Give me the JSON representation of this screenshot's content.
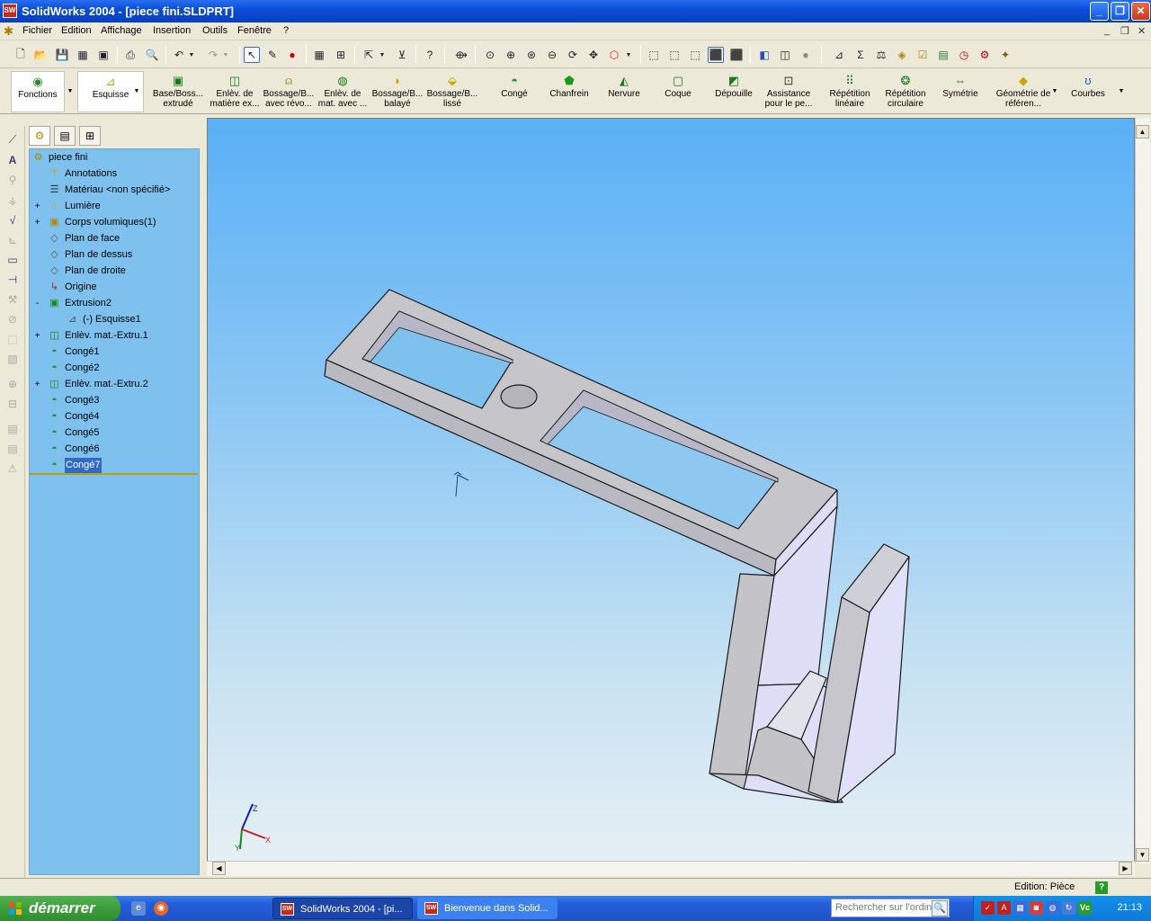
{
  "window": {
    "title": "SolidWorks 2004 - [piece fini.SLDPRT]",
    "logo_text": "SW"
  },
  "menu": [
    "Fichier",
    "Edition",
    "Affichage",
    "Insertion",
    "Outils",
    "Fenêtre",
    "?"
  ],
  "feature_toolbar": [
    {
      "label": "Fonctions",
      "icon": "features-icon"
    },
    {
      "label": "Esquisse",
      "icon": "sketch-icon"
    },
    {
      "label": "Base/Boss... extrudé",
      "icon": "extruded-boss-icon"
    },
    {
      "label": "Enlèv. de matière ex...",
      "icon": "extruded-cut-icon"
    },
    {
      "label": "Bossage/B... avec révo...",
      "icon": "revolved-boss-icon"
    },
    {
      "label": "Enlèv. de mat. avec ...",
      "icon": "revolved-cut-icon"
    },
    {
      "label": "Bossage/B... balayé",
      "icon": "swept-boss-icon"
    },
    {
      "label": "Bossage/B... lissé",
      "icon": "lofted-boss-icon"
    },
    {
      "label": "Congé",
      "icon": "fillet-icon"
    },
    {
      "label": "Chanfrein",
      "icon": "chamfer-icon"
    },
    {
      "label": "Nervure",
      "icon": "rib-icon"
    },
    {
      "label": "Coque",
      "icon": "shell-icon"
    },
    {
      "label": "Dépouille",
      "icon": "draft-icon"
    },
    {
      "label": "Assistance pour le pe...",
      "icon": "hole-wizard-icon"
    },
    {
      "label": "Répétition linéaire",
      "icon": "linear-pattern-icon"
    },
    {
      "label": "Répétition circulaire",
      "icon": "circular-pattern-icon"
    },
    {
      "label": "Symétrie",
      "icon": "mirror-icon"
    },
    {
      "label": "Géométrie de référen...",
      "icon": "reference-geometry-icon"
    },
    {
      "label": "Courbes",
      "icon": "curves-icon"
    }
  ],
  "tree": {
    "root": "piece fini",
    "items": [
      {
        "label": "Annotations",
        "icon": "annotations-icon",
        "expander": ""
      },
      {
        "label": "Matériau <non spécifié>",
        "icon": "material-icon",
        "expander": ""
      },
      {
        "label": "Lumière",
        "icon": "lights-icon",
        "expander": "+"
      },
      {
        "label": "Corps volumiques(1)",
        "icon": "solid-bodies-icon",
        "expander": "+"
      },
      {
        "label": "Plan de face",
        "icon": "plane-icon",
        "expander": ""
      },
      {
        "label": "Plan de dessus",
        "icon": "plane-icon",
        "expander": ""
      },
      {
        "label": "Plan de droite",
        "icon": "plane-icon",
        "expander": ""
      },
      {
        "label": "Origine",
        "icon": "origin-icon",
        "expander": ""
      },
      {
        "label": "Extrusion2",
        "icon": "extrude-icon",
        "expander": "-"
      },
      {
        "label": "(-) Esquisse1",
        "icon": "sketch-icon",
        "expander": ""
      },
      {
        "label": "Enlèv. mat.-Extru.1",
        "icon": "cut-extrude-icon",
        "expander": "+"
      },
      {
        "label": "Congé1",
        "icon": "fillet-icon",
        "expander": ""
      },
      {
        "label": "Congé2",
        "icon": "fillet-icon",
        "expander": ""
      },
      {
        "label": "Enlèv. mat.-Extru.2",
        "icon": "cut-extrude-icon",
        "expander": "+"
      },
      {
        "label": "Congé3",
        "icon": "fillet-icon",
        "expander": ""
      },
      {
        "label": "Congé4",
        "icon": "fillet-icon",
        "expander": ""
      },
      {
        "label": "Congé5",
        "icon": "fillet-icon",
        "expander": ""
      },
      {
        "label": "Congé6",
        "icon": "fillet-icon",
        "expander": ""
      },
      {
        "label": "Congé7",
        "icon": "fillet-icon",
        "expander": "",
        "selected": true
      }
    ]
  },
  "viewport": {
    "triad_labels": [
      "Z",
      "X",
      "Y"
    ],
    "background_top": "#5ab0f6",
    "background_bottom": "#e6eff5"
  },
  "status": {
    "mode": "Edition: Pièce",
    "help": "?"
  },
  "taskbar": {
    "start": "démarrer",
    "tasks": [
      "SolidWorks 2004 - [pi...",
      "Bienvenue dans Solid..."
    ],
    "search_placeholder": "Rechercher sur l'ordin",
    "clock": "21:13"
  },
  "colors": {
    "title_blue": "#0a4ed8",
    "tree_bg": "#7ec1ee",
    "selection": "#316ac5",
    "start_green": "#2e8d2e"
  }
}
